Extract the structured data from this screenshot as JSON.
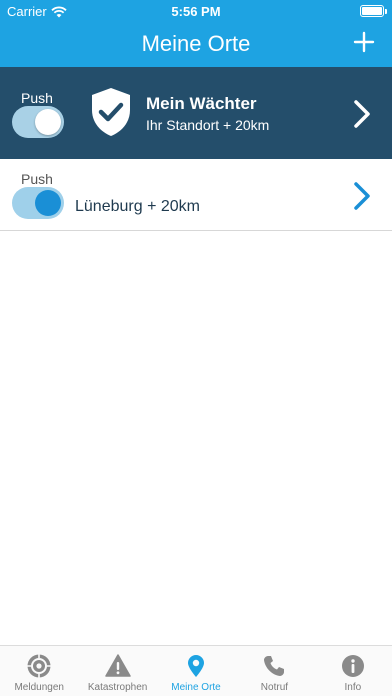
{
  "status_bar": {
    "carrier": "Carrier",
    "time": "5:56 PM"
  },
  "nav": {
    "title": "Meine Orte"
  },
  "guardian": {
    "push_label": "Push",
    "push_on": true,
    "title": "Mein Wächter",
    "subtitle": "Ihr Standort + 20km"
  },
  "places": [
    {
      "push_label": "Push",
      "push_on": true,
      "name": "Lüneburg + 20km"
    }
  ],
  "tabs": [
    {
      "label": "Meldungen",
      "icon": "siren-icon",
      "active": false
    },
    {
      "label": "Katastrophen",
      "icon": "warning-icon",
      "active": false
    },
    {
      "label": "Meine Orte",
      "icon": "location-pin-icon",
      "active": true
    },
    {
      "label": "Notruf",
      "icon": "phone-icon",
      "active": false
    },
    {
      "label": "Info",
      "icon": "info-icon",
      "active": false
    }
  ],
  "colors": {
    "accent": "#1ea3e2",
    "guardian_bg": "#244e6b",
    "tab_inactive": "#7a7a7a"
  }
}
